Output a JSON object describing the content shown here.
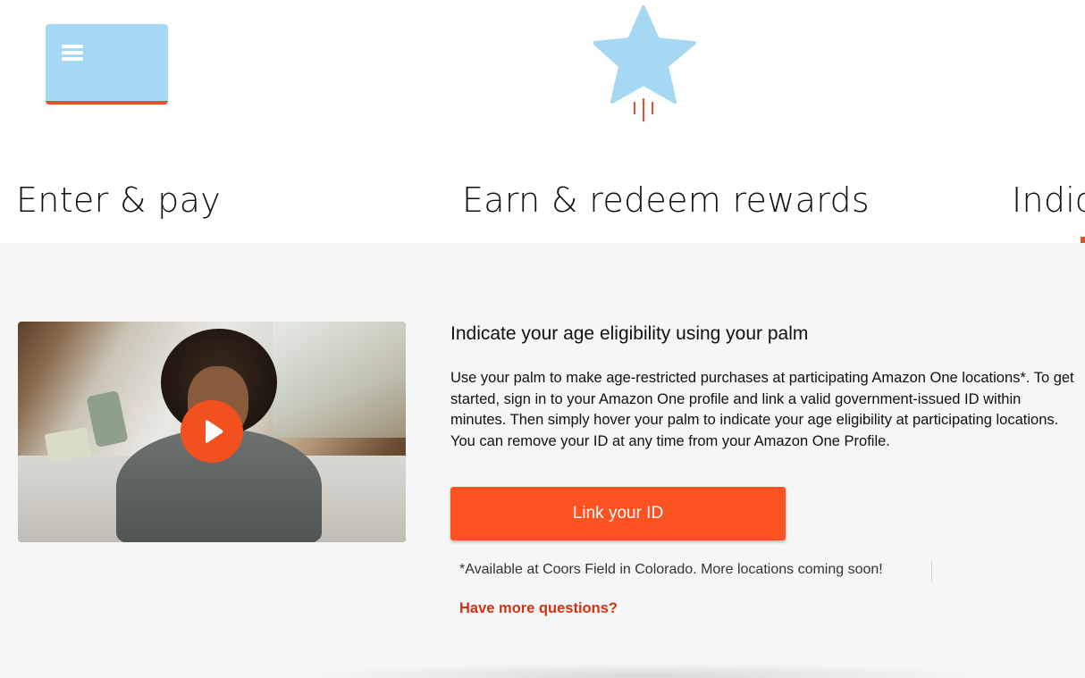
{
  "tabs": [
    {
      "label": "Enter & pay",
      "icon": "card-menu-icon"
    },
    {
      "label": "Earn & redeem rewards",
      "icon": "star-icon"
    },
    {
      "label": "Indic"
    }
  ],
  "colors": {
    "accent": "#fd5222",
    "icon_fill": "#a5d8f2",
    "link": "#d13212",
    "section_bg": "#f5f7f7"
  },
  "video": {
    "play_icon": "play-icon"
  },
  "content": {
    "heading": "Indicate your age eligibility using your palm",
    "body": "Use your palm to make age-restricted purchases at participating Amazon One locations*. To get started, sign in to your Amazon One profile and link a valid government-issued ID within minutes. Then simply hover your palm to indicate your age eligibility at participating locations. You can remove your ID at any time from your Amazon One Profile.",
    "cta_label": "Link your ID",
    "footnote": "*Available at Coors Field in Colorado. More locations coming soon!",
    "questions_link": "Have more questions?"
  }
}
